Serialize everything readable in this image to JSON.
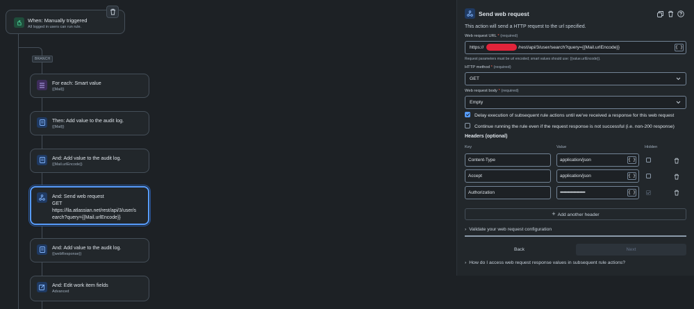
{
  "trigger": {
    "title": "When: Manually triggered",
    "subtitle": "All logged in users can run rule.",
    "icon": "hand-pointer-icon"
  },
  "branch_label": "BRANCH",
  "steps": [
    {
      "title": "For each: Smart value",
      "subtitle": "{{Mail}}",
      "icon": "list-icon",
      "color": "purple"
    },
    {
      "title": "Then: Add value to the audit log.",
      "subtitle": "{{Mail}}",
      "icon": "document-icon",
      "color": "blue"
    },
    {
      "title": "And: Add value to the audit log.",
      "subtitle": "{{Mail.urlEncode}}",
      "icon": "document-icon",
      "color": "blue"
    },
    {
      "title": "And: Send web request",
      "body_line1": "GET",
      "body_line2": "https://lla.atlassian.net/rest/api/3/user/s",
      "body_line3": "earch?query={{Mail.urlEncode}}",
      "icon": "webhook-icon",
      "color": "blue",
      "selected": true
    },
    {
      "title": "And: Add value to the audit log.",
      "subtitle": "{{webResponse}}",
      "icon": "document-icon",
      "color": "blue"
    },
    {
      "title": "And: Edit work item fields",
      "subtitle": "Advanced",
      "icon": "edit-icon",
      "color": "blue"
    }
  ],
  "panel": {
    "title": "Send web request",
    "description": "This action will send a HTTP request to the url specified.",
    "url": {
      "label": "Web request URL",
      "required_mark": "*",
      "required_hint": "(required)",
      "value_prefix": "https://",
      "value_suffix": "/rest/api/3/user/search?query={{Mail.urlEncode}}",
      "help": "Request parameters must be url encoded; smart values should use: {{value.urlEncode}}."
    },
    "method": {
      "label": "HTTP method",
      "required_mark": "*",
      "required_hint": "(required)",
      "value": "GET"
    },
    "body": {
      "label": "Web request body",
      "required_mark": "*",
      "required_hint": "(required)",
      "value": "Empty"
    },
    "delay_checkbox": {
      "label": "Delay execution of subsequent rule actions until we've received a response for this web request",
      "checked": true
    },
    "continue_checkbox": {
      "label": "Continue running the rule even if the request response is not successful (i.e. non-200 response)",
      "checked": false
    },
    "headers": {
      "title": "Headers (optional)",
      "col_key": "Key",
      "col_value": "Value",
      "col_hidden": "Hidden",
      "rows": [
        {
          "key": "Content-Type",
          "value": "application/json",
          "hidden": false
        },
        {
          "key": "Accept",
          "value": "application/json",
          "hidden": false
        },
        {
          "key": "Authorization",
          "value": "••••••••••••••••••••••••••••",
          "hidden": true
        }
      ],
      "add_label": "Add another header"
    },
    "validate_label": "Validate your web request configuration",
    "back_label": "Back",
    "next_label": "Next",
    "access_help": "How do I access web request response values in subsequent rule actions?"
  },
  "colors": {
    "accent": "#579dff",
    "required": "#ef5c48",
    "background": "#1d2125",
    "surface": "#22272b"
  }
}
